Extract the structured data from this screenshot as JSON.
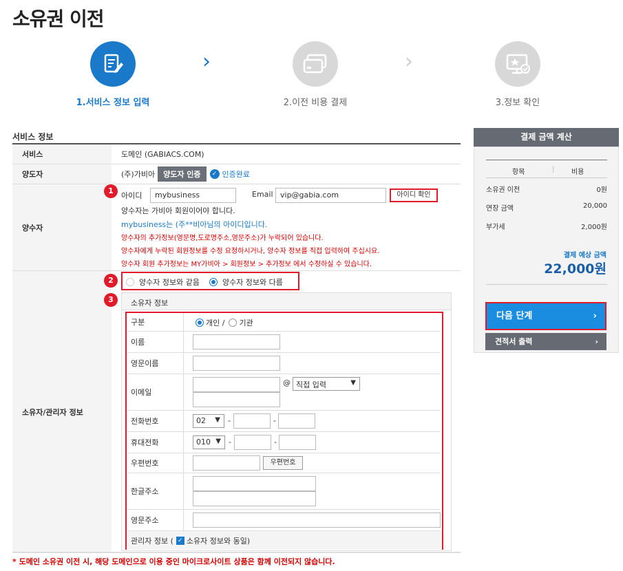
{
  "page": {
    "title": "소유권 이전"
  },
  "steps": [
    {
      "label": "1.서비스 정보 입력"
    },
    {
      "label": "2.이전 비용 결제"
    },
    {
      "label": "3.정보 확인"
    }
  ],
  "colors": {
    "accent": "#1a79c9",
    "highlight": "#e01b2a",
    "panel_dark": "#666b73",
    "next_button": "#1a8de0"
  },
  "section": {
    "title": "서비스 정보"
  },
  "service": {
    "label": "서비스",
    "value": "도메인 (GABIACS.COM)"
  },
  "transferor": {
    "label": "양도자",
    "value": "(주)가비아",
    "auth_button": "양도자 인증",
    "auth_status": "인증완료"
  },
  "transferee": {
    "label": "양수자",
    "id_label": "아이디",
    "id_value": "mybusiness",
    "email_label": "Email",
    "email_value": "vip@gabia.com",
    "check_button": "아이디 확인",
    "msg1": "양수자는 가비아 회원이어야 합니다.",
    "msg2": "mybusiness는 (주**비아님의 아이디입니다.",
    "msg3": "양수자의 추가정보(영문명,도로명주소,영문주소)가 누락되어 있습니다.",
    "msg4": "양수자에게 누락된 회원정보를 수정 요청하시거나, 양수자 정보를 직접 입력하여 주십시요.",
    "msg5": "양수자 회원 추가정보는 MY가비아 > 회원정보 > 추가정보 에서 수정하실 수 있습니다."
  },
  "badges": [
    "1",
    "2",
    "3"
  ],
  "owner": {
    "label": "소유자/관리자 정보",
    "option_same": "양수자 정보와 같음",
    "option_diff": "양수자 정보와 다름",
    "box_title": "소유자 정보",
    "type_label": "구분",
    "type_individual": "개인 /",
    "type_org": "기관",
    "name_label": "이름",
    "eng_name_label": "영문이름",
    "email_label": "이메일",
    "at_symbol": "@",
    "email_domain_select": "직접 입력",
    "phone_label": "전화번호",
    "phone_prefix": "02",
    "mobile_label": "휴대전화",
    "mobile_prefix": "010",
    "dash": "-",
    "zip_label": "우편번호",
    "zip_button": "우편번호",
    "kor_address_label": "한글주소",
    "eng_address_label": "영문주소",
    "manager_label_prefix": "관리자 정보 (",
    "manager_checkbox_label": "소유자 정보와 동일)"
  },
  "footnote": "* 도메인 소유권 이전 시, 해당 도메인으로 이용 중인 마이크로사이트 상품은 함께 이전되지 않습니다.",
  "payment": {
    "header": "결제 금액 계산",
    "col_item": "항목",
    "col_cost": "비용",
    "rows": [
      {
        "item": "소유권 이전",
        "cost": "0원"
      },
      {
        "item": "연장 금액",
        "cost": "20,000"
      },
      {
        "item": "부가세",
        "cost": "2,000원"
      }
    ],
    "expected_label": "결제 예상 금액",
    "expected_amount": "22,000원",
    "next_button": "다음 단계",
    "quote_button": "견적서 출력",
    "chevron": "›"
  }
}
